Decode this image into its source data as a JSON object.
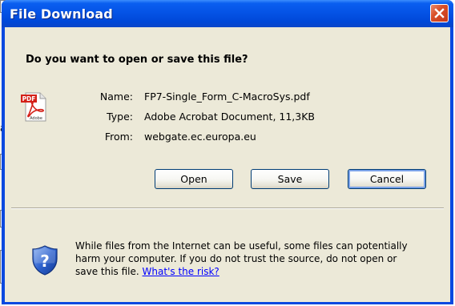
{
  "window": {
    "title": "File Download"
  },
  "dialog": {
    "question": "Do you want to open or save this file?",
    "file": {
      "name_label": "Name:",
      "name_value": "FP7-Single_Form_C-MacroSys.pdf",
      "type_label": "Type:",
      "type_value": "Adobe Acrobat Document, 11,3KB",
      "from_label": "From:",
      "from_value": "webgate.ec.europa.eu",
      "icon_badge": "PDF",
      "icon_caption": "Adobe"
    },
    "buttons": {
      "open": "Open",
      "save": "Save",
      "cancel": "Cancel"
    },
    "warning": {
      "line1": "While files from the Internet can be useful, some files can potentially",
      "line2": "harm your computer. If you do not trust the source, do not open or",
      "line3": "save this file.",
      "link": "What's the risk?"
    }
  },
  "background": {
    "fragment": "a"
  },
  "colors": {
    "titlebar": "#0553e6",
    "dialog_bg": "#ece9d8",
    "close_button": "#d8502a",
    "link": "#0000ff",
    "pdf_red": "#d42018"
  }
}
